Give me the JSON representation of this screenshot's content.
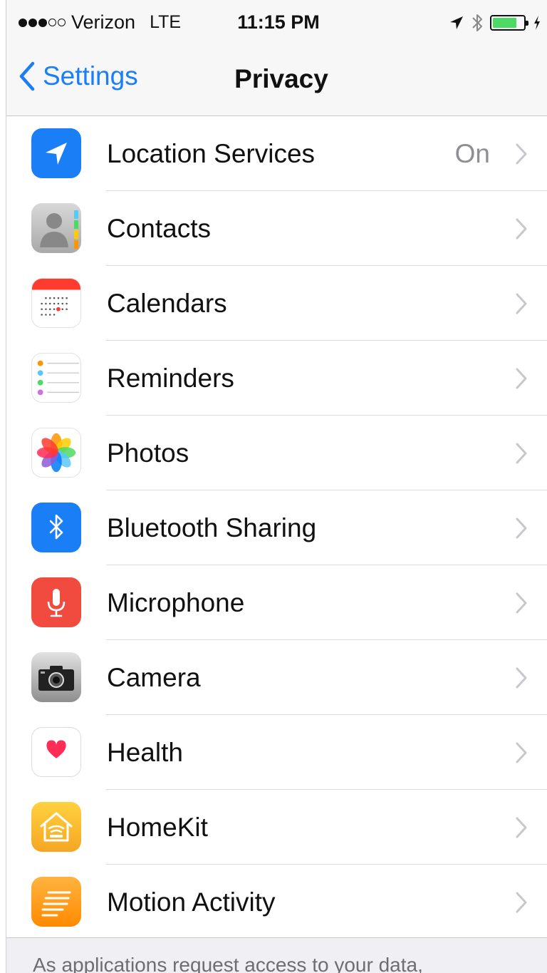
{
  "status_bar": {
    "carrier": "Verizon",
    "network": "LTE",
    "time": "11:15 PM",
    "signal_bars_filled": 3,
    "signal_bars_total": 5,
    "battery_level": 0.8,
    "icons": [
      "location-arrow-icon",
      "bluetooth-icon",
      "battery-icon",
      "charging-icon"
    ]
  },
  "nav": {
    "back_label": "Settings",
    "title": "Privacy"
  },
  "items": [
    {
      "label": "Location Services",
      "detail": "On",
      "icon": "location-services-icon",
      "color": "#1a7ef7"
    },
    {
      "label": "Contacts",
      "detail": "",
      "icon": "contacts-icon",
      "color": "#9a9a9a"
    },
    {
      "label": "Calendars",
      "detail": "",
      "icon": "calendar-icon",
      "color": "#ff3b30"
    },
    {
      "label": "Reminders",
      "detail": "",
      "icon": "reminders-icon",
      "color": "#ffffff"
    },
    {
      "label": "Photos",
      "detail": "",
      "icon": "photos-icon",
      "color": "#ffffff"
    },
    {
      "label": "Bluetooth Sharing",
      "detail": "",
      "icon": "bluetooth-sharing-icon",
      "color": "#1a7ef7"
    },
    {
      "label": "Microphone",
      "detail": "",
      "icon": "microphone-icon",
      "color": "#f04b3e"
    },
    {
      "label": "Camera",
      "detail": "",
      "icon": "camera-icon",
      "color": "#6e6e6e"
    },
    {
      "label": "Health",
      "detail": "",
      "icon": "health-icon",
      "color": "#ff2d55"
    },
    {
      "label": "HomeKit",
      "detail": "",
      "icon": "homekit-icon",
      "color": "#f7b500"
    },
    {
      "label": "Motion Activity",
      "detail": "",
      "icon": "motion-activity-icon",
      "color": "#ff9500"
    }
  ],
  "footer": {
    "text": "As applications request access to your data,"
  },
  "colors": {
    "accent": "#1a7ef7",
    "separator": "#dcdcdc",
    "chevron": "#c7c7cc",
    "secondary_text": "#8e8e93"
  }
}
